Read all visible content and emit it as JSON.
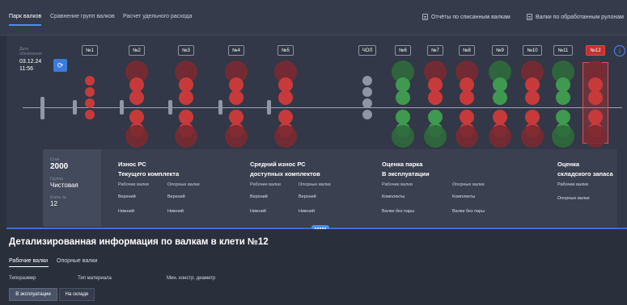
{
  "tabs": {
    "park": "Парк валков",
    "compare": "Сравнение групп валков",
    "calc": "Расчет удельного расхода"
  },
  "top_links": {
    "reports": "Отчёты по списанным валкам",
    "rolls": "Валки по обработанным рулонам"
  },
  "update": {
    "label": "Дата обновления",
    "date": "03.12.24",
    "time": "11:56"
  },
  "stands": [
    {
      "label": "№1",
      "status": "red"
    },
    {
      "label": "№2",
      "status": "red"
    },
    {
      "label": "№3",
      "status": "red"
    },
    {
      "label": "№4",
      "status": "red"
    },
    {
      "label": "№5",
      "status": "red"
    },
    {
      "label": "ЧОЛ",
      "status": "gray"
    },
    {
      "label": "№6",
      "status": "green"
    },
    {
      "label": "№7",
      "status": "mixed"
    },
    {
      "label": "№8",
      "status": "red"
    },
    {
      "label": "№9",
      "status": "mixed"
    },
    {
      "label": "№10",
      "status": "red"
    },
    {
      "label": "№11",
      "status": "green"
    },
    {
      "label": "№12",
      "status": "red",
      "selected": true
    }
  ],
  "summary": {
    "stan_label": "Стан",
    "stan_value": "2000",
    "group_label": "Группа",
    "group_value": "Чистовая",
    "stand_label": "Клеть №",
    "stand_value": "12",
    "col1": {
      "title1": "Износ РС",
      "title2": "Текущего комплекта",
      "sub_work": "Рабочие валки",
      "sub_back": "Опорные валки",
      "upper1": "Верхний",
      "upper2": "Верхний",
      "lower1": "Нижний",
      "lower2": "Нижний"
    },
    "col2": {
      "title1": "Средний износ РС",
      "title2": "доступных комплектов",
      "sub_work": "Рабочие валки",
      "sub_back": "Опорные валки",
      "upper1": "Верхний",
      "upper2": "Верхний",
      "lower1": "Нижний",
      "lower2": "Нижний"
    },
    "col3": {
      "title1": "Оценка парка",
      "title2": "В эксплуатации",
      "sub_work": "Рабочие валки",
      "sub_back": "Опорные валки",
      "kits1": "Комплекты",
      "kits2": "Комплекты",
      "unpaired1": "Валки без пары",
      "unpaired2": "Валки без пары"
    },
    "col4": {
      "title1": "Оценка",
      "title2": "складского запаса",
      "work": "Рабочие валки",
      "back": "Опорные валки"
    }
  },
  "detail": {
    "title": "Детализированная информация по валкам в клети №12",
    "tab_work": "Рабочие валки",
    "tab_back": "Опорные валки",
    "field_size": "Типоразмер",
    "field_material": "Тип материала",
    "field_diameter": "Мин. констр. диаметр",
    "seg_in_use": "В эксплуатации",
    "seg_stock": "На складе"
  },
  "colors": {
    "red": "#c83a3a",
    "green": "#3f9a4f",
    "gray": "#8e96a6",
    "accent": "#4a8cff"
  }
}
